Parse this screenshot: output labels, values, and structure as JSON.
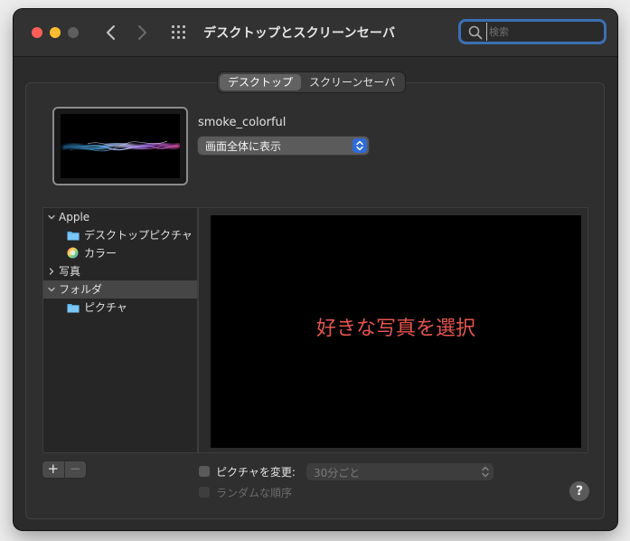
{
  "window": {
    "title": "デスクトップとスクリーンセーバ"
  },
  "search": {
    "placeholder": "検索",
    "value": ""
  },
  "tabs": [
    {
      "label": "デスクトップ",
      "active": true
    },
    {
      "label": "スクリーンセーバ",
      "active": false
    }
  ],
  "current_wallpaper": {
    "name": "smoke_colorful",
    "fit_option": "画面全体に表示"
  },
  "sidebar": {
    "items": [
      {
        "label": "Apple",
        "expanded": true,
        "selected": false
      },
      {
        "label": "デスクトップピクチャ",
        "icon": "folder-icon"
      },
      {
        "label": "カラー",
        "icon": "color-wheel-icon"
      },
      {
        "label": "写真",
        "expanded": false,
        "selected": false
      },
      {
        "label": "フォルダ",
        "expanded": true,
        "selected": true
      },
      {
        "label": "ピクチャ",
        "icon": "folder-icon"
      }
    ]
  },
  "preview": {
    "message": "好きな写真を選択"
  },
  "list_controls": {
    "add_label": "+",
    "remove_label": "−"
  },
  "options": {
    "change_picture_label": "ピクチャを変更:",
    "change_picture_checked": false,
    "interval_value": "30分ごと",
    "random_order_label": "ランダムな順序",
    "random_order_checked": false
  },
  "help": {
    "label": "?"
  },
  "colors": {
    "accent": "#2f6bd6",
    "focus_ring": "#3b6fb3",
    "preview_message": "#e5554e",
    "close": "#ff5f57",
    "minimize": "#febc2e"
  }
}
